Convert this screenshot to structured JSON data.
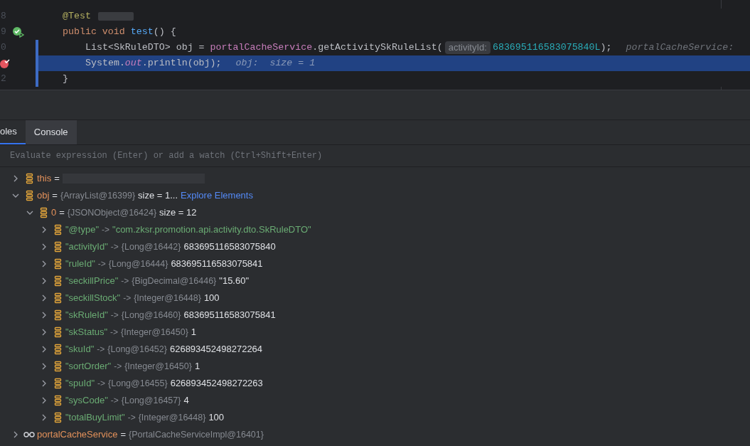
{
  "editor": {
    "lines": [
      {
        "number": "8",
        "kind": "annotation_line",
        "current": false,
        "tokens": [
          {
            "kind": "annotation",
            "text": "@Test"
          }
        ]
      },
      {
        "number": "9",
        "kind": "test_method",
        "current": false,
        "tokens": [
          {
            "kind": "keyword",
            "text": "public void "
          },
          {
            "kind": "method",
            "text": "test"
          },
          {
            "kind": "plain",
            "text": "() {"
          }
        ]
      },
      {
        "number": "0",
        "kind": "statement",
        "current": false,
        "tokens": [
          {
            "kind": "plain",
            "text": "List<SkRuleDTO> obj = "
          },
          {
            "kind": "field",
            "text": "portalCacheService"
          },
          {
            "kind": "plain",
            "text": ".getActivitySkRuleList("
          },
          {
            "kind": "param_hint",
            "text": "activityId:"
          },
          {
            "kind": "number",
            "text": "683695116583075840L"
          },
          {
            "kind": "plain",
            "text": ");"
          },
          {
            "kind": "debug_hint",
            "text": "portalCacheService:"
          }
        ]
      },
      {
        "kind": "breakpoint_statement",
        "current": true,
        "tokens": [
          {
            "kind": "plain",
            "text": "System."
          },
          {
            "kind": "static_field",
            "text": "out"
          },
          {
            "kind": "plain",
            "text": ".println(obj);"
          },
          {
            "kind": "debug_hint",
            "text": "obj:  size = 1"
          }
        ]
      },
      {
        "number": "2",
        "kind": "block_end",
        "current": false,
        "tokens": [
          {
            "kind": "plain",
            "text": "}"
          }
        ]
      }
    ]
  },
  "debug": {
    "tabs": [
      {
        "label": "oles",
        "selected": true
      },
      {
        "label": "Console",
        "selected": false
      }
    ],
    "evaluate": {
      "placeholder": "Evaluate expression (Enter) or add a watch (Ctrl+Shift+Enter)"
    },
    "tree": [
      {
        "kind": "variable",
        "name": "this",
        "separator": "=",
        "expanded": false
      },
      {
        "kind": "variable",
        "name": "obj",
        "separator": "=",
        "type": "{ArrayList@16399}",
        "value": "size = 1...",
        "link": "Explore Elements",
        "expanded": true,
        "children": [
          {
            "kind": "variable",
            "name": "0",
            "separator": "=",
            "type": "{JSONObject@16424}",
            "value": "size = 12",
            "expanded": true,
            "children": [
              {
                "kind": "string_entry",
                "name": "\"@type\"",
                "separator": "->",
                "value": "\"com.zksr.promotion.api.activity.dto.SkRuleDTO\"",
                "expanded": false
              },
              {
                "kind": "entry",
                "name": "\"activityId\"",
                "separator": "->",
                "type": "{Long@16442}",
                "value": "683695116583075840",
                "expanded": false
              },
              {
                "kind": "entry",
                "name": "\"ruleId\"",
                "separator": "->",
                "type": "{Long@16444}",
                "value": "683695116583075841",
                "expanded": false
              },
              {
                "kind": "entry",
                "name": "\"seckillPrice\"",
                "separator": "->",
                "type": "{BigDecimal@16446}",
                "value": "\"15.60\"",
                "expanded": false
              },
              {
                "kind": "entry",
                "name": "\"seckillStock\"",
                "separator": "->",
                "type": "{Integer@16448}",
                "value": "100",
                "expanded": false
              },
              {
                "kind": "entry",
                "name": "\"skRuleId\"",
                "separator": "->",
                "type": "{Long@16460}",
                "value": "683695116583075841",
                "expanded": false
              },
              {
                "kind": "entry",
                "name": "\"skStatus\"",
                "separator": "->",
                "type": "{Integer@16450}",
                "value": "1",
                "expanded": false
              },
              {
                "kind": "entry",
                "name": "\"skuId\"",
                "separator": "->",
                "type": "{Long@16452}",
                "value": "626893452498272264",
                "expanded": false
              },
              {
                "kind": "entry",
                "name": "\"sortOrder\"",
                "separator": "->",
                "type": "{Integer@16450}",
                "value": "1",
                "expanded": false
              },
              {
                "kind": "entry",
                "name": "\"spuId\"",
                "separator": "->",
                "type": "{Long@16455}",
                "value": "626893452498272263",
                "expanded": false
              },
              {
                "kind": "entry",
                "name": "\"sysCode\"",
                "separator": "->",
                "type": "{Long@16457}",
                "value": "4",
                "expanded": false
              },
              {
                "kind": "entry",
                "name": "\"totalBuyLimit\"",
                "separator": "->",
                "type": "{Integer@16448}",
                "value": "100",
                "expanded": false
              }
            ]
          }
        ]
      },
      {
        "kind": "watch",
        "name": "portalCacheService",
        "separator": "=",
        "type": "{PortalCacheServiceImpl@16401}",
        "expanded": false
      }
    ]
  }
}
